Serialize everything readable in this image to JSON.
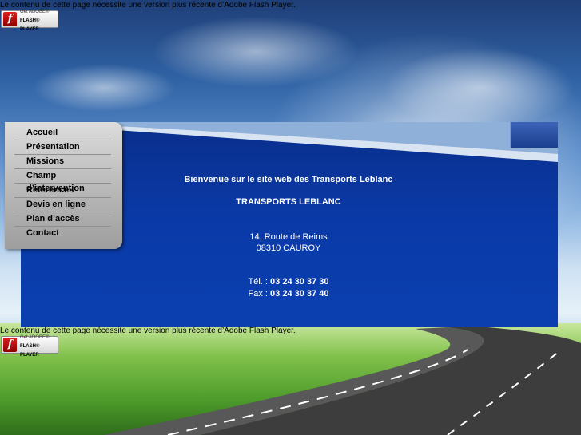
{
  "flash_notice": {
    "message": "Le contenu de cette page nécessite une version plus récente d’Adobe Flash Player.",
    "badge_line1": "Get ADOBE®",
    "badge_line2": "FLASH® PLAYER",
    "logo_glyph": "f"
  },
  "menu": {
    "items": [
      {
        "label": "Accueil"
      },
      {
        "label": "Présentation"
      },
      {
        "label": "Missions"
      },
      {
        "label": "Champ d’intervention"
      },
      {
        "label": "Références"
      },
      {
        "label": "Devis en ligne"
      },
      {
        "label": "Plan d’accès"
      },
      {
        "label": "Contact"
      }
    ]
  },
  "main": {
    "welcome": "Bienvenue sur le site web des Transports Leblanc",
    "company": "TRANSPORTS LEBLANC",
    "address_line1": "14, Route de Reims",
    "address_line2": "08310 CAUROY",
    "tel_label": "Tél. : ",
    "tel_value": "03 24 30 37 30",
    "fax_label": "Fax : ",
    "fax_value": "03 24 30 37 40"
  },
  "colors": {
    "banner_blue": "#0b3fb0",
    "menu_gray": "#bdbdbd"
  }
}
